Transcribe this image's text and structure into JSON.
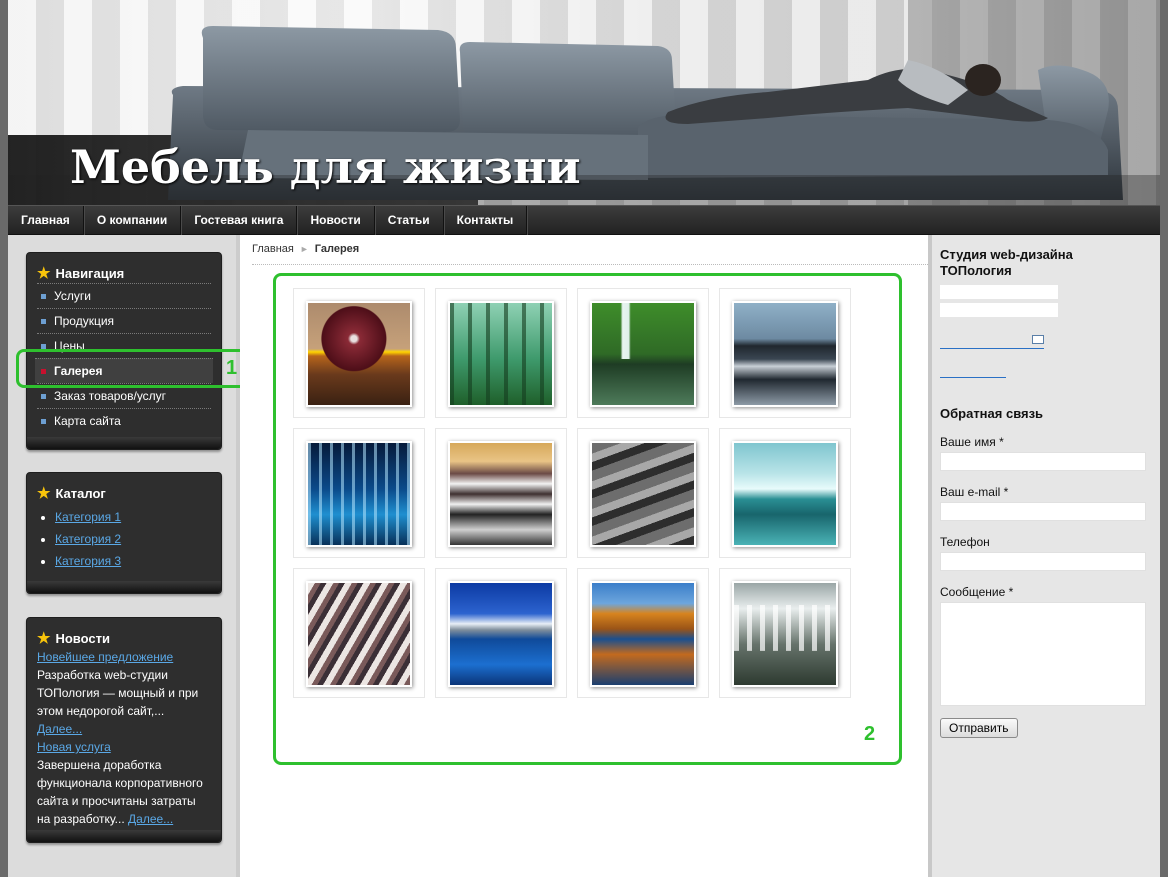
{
  "header": {
    "site_title": "Мебель для жизни"
  },
  "topnav": [
    {
      "label": "Главная"
    },
    {
      "label": "О компании"
    },
    {
      "label": "Гостевая книга"
    },
    {
      "label": "Новости"
    },
    {
      "label": "Статьи"
    },
    {
      "label": "Контакты"
    }
  ],
  "navigation": {
    "title": "Навигация",
    "items": [
      {
        "label": "Услуги"
      },
      {
        "label": "Продукция"
      },
      {
        "label": "Цены"
      },
      {
        "label": "Галерея",
        "active": true
      },
      {
        "label": "Заказ товаров/услуг"
      },
      {
        "label": "Карта сайта"
      }
    ]
  },
  "catalog": {
    "title": "Каталог",
    "items": [
      {
        "label": "Категория 1"
      },
      {
        "label": "Категория 2"
      },
      {
        "label": "Категория 3"
      }
    ]
  },
  "news": {
    "title": "Новости",
    "items": [
      {
        "headline": "Новейшее предложение",
        "text": "Разработка web-студии ТОПология — мощный и при этом недорогой сайт,...",
        "more": "Далее..."
      },
      {
        "headline": "Новая услуга",
        "text": "Завершена доработка функционала корпоративного сайта и просчитаны затраты на разработку...",
        "more": "Далее..."
      }
    ]
  },
  "breadcrumb": {
    "home": "Главная",
    "current": "Галерея"
  },
  "annotations": {
    "label_1": "1",
    "label_2": "2"
  },
  "rightcol": {
    "studio": "Студия web-дизайна ТОПология",
    "feedback": {
      "title": "Обратная связь",
      "name_label": "Ваше имя *",
      "email_label": "Ваш e-mail *",
      "phone_label": "Телефон",
      "message_label": "Сообщение *",
      "submit": "Отправить"
    }
  },
  "colors": {
    "highlight": "#2ec02e",
    "link": "#5aa8e6",
    "star": "#f8c40b",
    "active_bullet": "#c8102e"
  },
  "gallery": {
    "thumbnails": [
      {
        "name": "sphere"
      },
      {
        "name": "forest"
      },
      {
        "name": "waterfall-lake"
      },
      {
        "name": "river-sunset"
      },
      {
        "name": "blue-waterfall"
      },
      {
        "name": "mountain-reflection"
      },
      {
        "name": "rocky-stream"
      },
      {
        "name": "iceberg"
      },
      {
        "name": "rocky-mountains"
      },
      {
        "name": "blue-lake"
      },
      {
        "name": "autumn-lake"
      },
      {
        "name": "big-waterfall"
      }
    ]
  }
}
